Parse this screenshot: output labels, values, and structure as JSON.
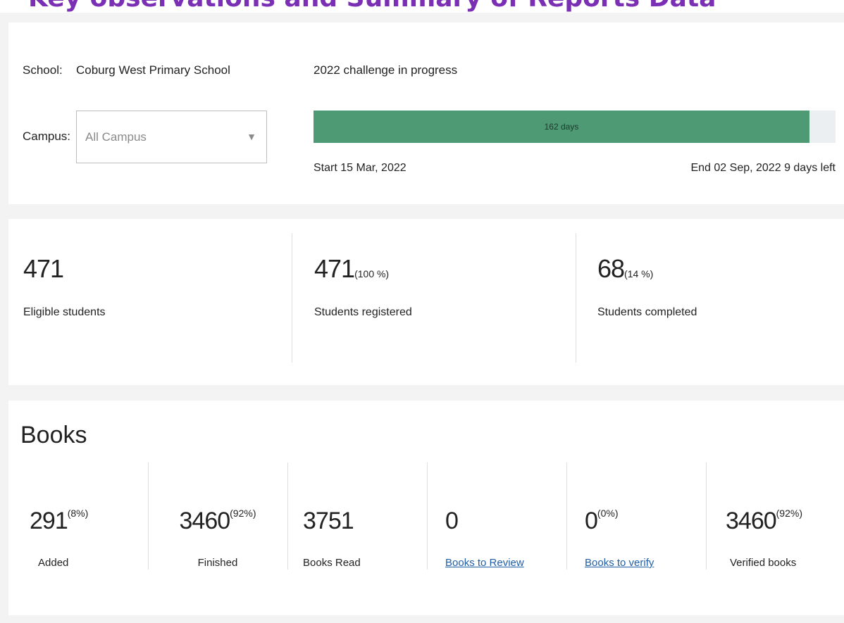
{
  "banner": {
    "text": "Key observations and Summary of Reports Data"
  },
  "header": {
    "school_label": "School:",
    "school_name": "Coburg West Primary School",
    "campus_label": "Campus:",
    "campus_selected": "All Campus",
    "challenge_title": "2022 challenge in progress",
    "progress_label": "162 days",
    "progress_fraction": 0.95,
    "start_prefix": "Start",
    "start_date": "15 Mar, 2022",
    "end_prefix": "End",
    "end_date": "02 Sep, 2022",
    "days_left": "9 days left"
  },
  "stats": [
    {
      "value": "471",
      "pct": "",
      "label": "Eligible students"
    },
    {
      "value": "471",
      "pct": "(100 %)",
      "label": "Students registered"
    },
    {
      "value": "68",
      "pct": "(14 %)",
      "label": "Students completed"
    }
  ],
  "books": {
    "title": "Books",
    "items": [
      {
        "value": "291",
        "pct": "(8%)",
        "label": "Added"
      },
      {
        "value": "3460",
        "pct": "(92%)",
        "label": "Finished"
      },
      {
        "value": "3751",
        "pct": "",
        "label": "Books Read"
      },
      {
        "value": "0",
        "pct": "",
        "label": "Books to Review"
      },
      {
        "value": "0",
        "pct": "(0%)",
        "label": "Books to verify"
      },
      {
        "value": "3460",
        "pct": "(92%)",
        "label": "Verified books"
      }
    ]
  },
  "colors": {
    "progress": "#4e9a74",
    "link": "#1f5fa8",
    "banner": "#7a2fb4"
  }
}
